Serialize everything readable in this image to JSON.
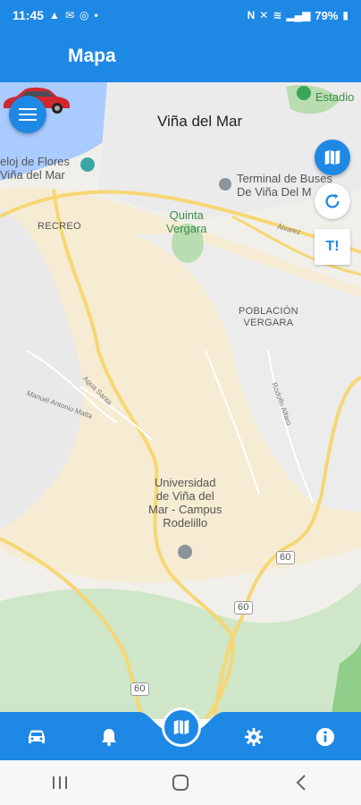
{
  "status_bar": {
    "time": "11:45",
    "battery": "79%"
  },
  "app_bar": {
    "title": "Mapa"
  },
  "map": {
    "labels": {
      "city": "Viña del Mar",
      "estadio": "Estadio",
      "reloj_line1": "eloj de Flores",
      "reloj_line2": "Viña del  Mar",
      "terminal_line1": "Terminal de Buses",
      "terminal_line2": "De Viña Del M",
      "recreo": "RECREO",
      "quinta_line1": "Quinta",
      "quinta_line2": "Vergara",
      "poblacion_line1": "POBLACIÓN",
      "poblacion_line2": "VERGARA",
      "universidad_line1": "Universidad",
      "universidad_line2": "de Viña del",
      "universidad_line3": "Mar - Campus",
      "universidad_line4": "Rodelillo",
      "route_60a": "60",
      "route_60b": "60",
      "route_60c": "60",
      "street_agua_santa": "Agua Santa",
      "street_rodolfo": "Rodolfo Alfaro",
      "street_alvarez": "Álvarez",
      "street_manuel": "Manuel Antonio Matta"
    },
    "traffic_label": "T!"
  },
  "colors": {
    "primary": "#1e88e5",
    "sea": "#aacbff",
    "park": "#c8e6c0",
    "road": "#f7d774"
  },
  "icons": {
    "menu": "menu-icon",
    "map": "map-icon",
    "refresh": "refresh-icon",
    "car": "car-icon",
    "bell": "bell-icon",
    "settings": "gear-icon",
    "info": "info-icon"
  }
}
